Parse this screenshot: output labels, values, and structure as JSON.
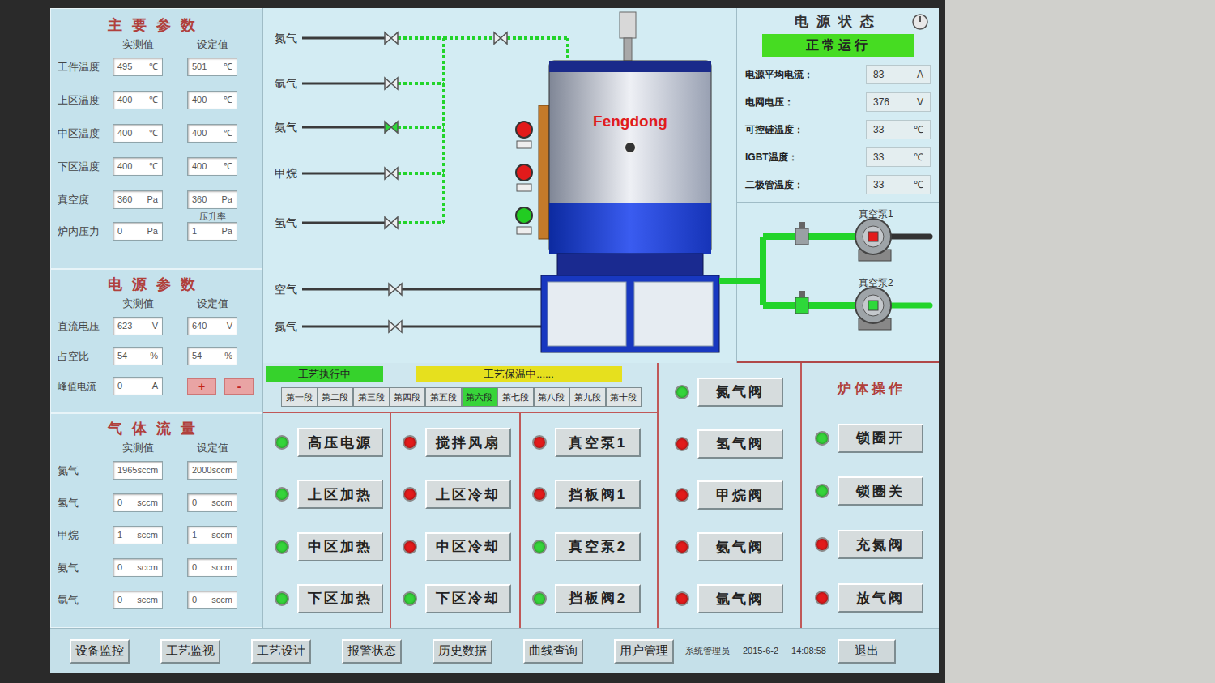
{
  "main_params": {
    "title": "主要参数",
    "headers": [
      "实测值",
      "设定值"
    ],
    "rows": [
      {
        "label": "工件温度",
        "measured": "495",
        "measured_unit": "℃",
        "set": "501",
        "set_unit": "℃"
      },
      {
        "label": "上区温度",
        "measured": "400",
        "measured_unit": "℃",
        "set": "400",
        "set_unit": "℃"
      },
      {
        "label": "中区温度",
        "measured": "400",
        "measured_unit": "℃",
        "set": "400",
        "set_unit": "℃"
      },
      {
        "label": "下区温度",
        "measured": "400",
        "measured_unit": "℃",
        "set": "400",
        "set_unit": "℃"
      },
      {
        "label": "真空度",
        "measured": "360",
        "measured_unit": "Pa",
        "set": "360",
        "set_unit": "Pa"
      }
    ],
    "pressure": {
      "label": "炉内压力",
      "measured": "0",
      "measured_unit": "Pa",
      "rise_label": "压升率",
      "set": "1",
      "set_unit": "Pa"
    }
  },
  "power_params": {
    "title": "电源参数",
    "headers": [
      "实测值",
      "设定值"
    ],
    "rows": [
      {
        "label": "直流电压",
        "measured": "623",
        "measured_unit": "V",
        "set": "640",
        "set_unit": "V"
      },
      {
        "label": "占空比",
        "measured": "54",
        "measured_unit": "%",
        "set": "54",
        "set_unit": "%"
      }
    ],
    "peak": {
      "label": "峰值电流",
      "measured": "0",
      "measured_unit": "A",
      "buttons": [
        "+",
        "-"
      ]
    }
  },
  "gas_flow": {
    "title": "气体流量",
    "headers": [
      "实测值",
      "设定值"
    ],
    "rows": [
      {
        "label": "氮气",
        "measured": "1965",
        "measured_unit": "sccm",
        "set": "2000",
        "set_unit": "sccm"
      },
      {
        "label": "氢气",
        "measured": "0",
        "measured_unit": "sccm",
        "set": "0",
        "set_unit": "sccm"
      },
      {
        "label": "甲烷",
        "measured": "1",
        "measured_unit": "sccm",
        "set": "1",
        "set_unit": "sccm"
      },
      {
        "label": "氨气",
        "measured": "0",
        "measured_unit": "sccm",
        "set": "0",
        "set_unit": "sccm"
      },
      {
        "label": "氩气",
        "measured": "0",
        "measured_unit": "sccm",
        "set": "0",
        "set_unit": "sccm"
      }
    ]
  },
  "diagram": {
    "gases": [
      {
        "name": "氮气",
        "open": false,
        "kind": "trunk"
      },
      {
        "name": "氩气",
        "open": false,
        "kind": "trunk"
      },
      {
        "name": "氨气",
        "open": true,
        "kind": "trunk"
      },
      {
        "name": "甲烷",
        "open": false,
        "kind": "trunk"
      },
      {
        "name": "氢气",
        "open": false,
        "kind": "trunk"
      },
      {
        "name": "空气",
        "open": false,
        "kind": "direct"
      },
      {
        "name": "氮气",
        "open": false,
        "kind": "direct"
      }
    ],
    "main_valve_open": false,
    "brand": "Fengdong",
    "lamps": [
      {
        "color": "#e21b1b"
      },
      {
        "color": "#e21b1b"
      },
      {
        "color": "#22cc22"
      }
    ]
  },
  "power_status": {
    "title": "电源状态",
    "status": "正常运行",
    "rows": [
      {
        "label": "电源平均电流：",
        "value": "83",
        "unit": "A"
      },
      {
        "label": "电网电压：",
        "value": "376",
        "unit": "V"
      },
      {
        "label": "可控硅温度：",
        "value": "33",
        "unit": "℃"
      },
      {
        "label": "IGBT温度：",
        "value": "33",
        "unit": "℃"
      },
      {
        "label": "二极管温度：",
        "value": "33",
        "unit": "℃"
      }
    ]
  },
  "vacuum_pumps": [
    {
      "label": "真空泵1",
      "running": false
    },
    {
      "label": "真空泵2",
      "running": true
    }
  ],
  "process": {
    "running": "工艺执行中",
    "phase": "工艺保温中......",
    "segments": [
      {
        "label": "第一段",
        "selected": false
      },
      {
        "label": "第二段",
        "selected": false
      },
      {
        "label": "第三段",
        "selected": false
      },
      {
        "label": "第四段",
        "selected": false
      },
      {
        "label": "第五段",
        "selected": false
      },
      {
        "label": "第六段",
        "selected": true
      },
      {
        "label": "第七段",
        "selected": false
      },
      {
        "label": "第八段",
        "selected": false
      },
      {
        "label": "第九段",
        "selected": false
      },
      {
        "label": "第十段",
        "selected": false
      }
    ]
  },
  "controls": [
    {
      "buttons": [
        {
          "label": "高压电源",
          "on": true
        },
        {
          "label": "上区加热",
          "on": true
        },
        {
          "label": "中区加热",
          "on": true
        },
        {
          "label": "下区加热",
          "on": true
        }
      ]
    },
    {
      "buttons": [
        {
          "label": "搅拌风扇",
          "on": false
        },
        {
          "label": "上区冷却",
          "on": false
        },
        {
          "label": "中区冷却",
          "on": false
        },
        {
          "label": "下区冷却",
          "on": true
        }
      ]
    },
    {
      "buttons": [
        {
          "label": "真空泵1",
          "on": false
        },
        {
          "label": "挡板阀1",
          "on": false
        },
        {
          "label": "真空泵2",
          "on": true
        },
        {
          "label": "挡板阀2",
          "on": true
        }
      ]
    }
  ],
  "valves": [
    {
      "label": "氮气阀",
      "on": true
    },
    {
      "label": "氢气阀",
      "on": false
    },
    {
      "label": "甲烷阀",
      "on": false
    },
    {
      "label": "氨气阀",
      "on": false
    },
    {
      "label": "氩气阀",
      "on": false
    }
  ],
  "furnace_ops": {
    "title": "炉体操作",
    "buttons": [
      {
        "label": "锁圈开",
        "on": true
      },
      {
        "label": "锁圈关",
        "on": true
      },
      {
        "label": "充氮阀",
        "on": false
      },
      {
        "label": "放气阀",
        "on": false
      }
    ]
  },
  "nav": {
    "items": [
      "设备监控",
      "工艺监视",
      "工艺设计",
      "报警状态",
      "历史数据",
      "曲线查询",
      "用户管理"
    ],
    "user": "系统管理员",
    "date": "2015-6-2",
    "time": "14:08:58",
    "exit": "退出"
  }
}
